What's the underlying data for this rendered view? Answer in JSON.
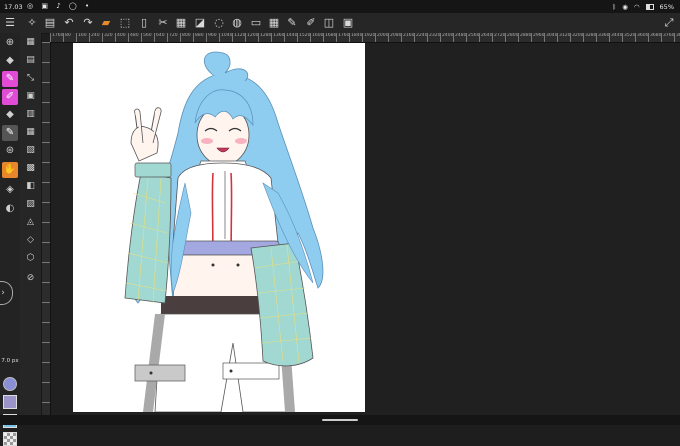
{
  "status_bar": {
    "time": "17.03",
    "notification_icons": [
      "whatsapp-icon",
      "gallery-icon",
      "music-icon",
      "chat-icon",
      "dot-icon"
    ],
    "right_icons": [
      "bluetooth-icon",
      "eye-icon",
      "wifi-icon",
      "battery-icon"
    ],
    "battery": "65%"
  },
  "toolbar": {
    "icons": [
      "menu-icon",
      "quick-access-icon",
      "save-icon",
      "undo-icon",
      "redo-icon",
      "brush-preset-icon",
      "transform-icon",
      "clear-layer-icon",
      "cut-icon",
      "paste-icon",
      "fill-icon",
      "lasso-icon",
      "gallery-icon",
      "folder-icon",
      "grid-icon",
      "pen-icon",
      "pen-alt-icon",
      "ruler-icon",
      "layer-props-icon",
      "fullscreen-icon"
    ]
  },
  "ruler": {
    "top_ticks": [
      "1760",
      "80",
      "160",
      "240",
      "320",
      "400",
      "480",
      "560",
      "640",
      "720",
      "800",
      "880",
      "960",
      "1040",
      "1120",
      "1200",
      "1280",
      "1360",
      "1440",
      "1520",
      "1600",
      "1680",
      "1760",
      "1840",
      "1920",
      "2000",
      "2080",
      "2160",
      "2240",
      "2320",
      "2400",
      "2480",
      "2560",
      "2640",
      "2720",
      "2800",
      "2880",
      "2960",
      "3040",
      "3120",
      "3200",
      "3280",
      "3360",
      "3440",
      "3520",
      "3600",
      "3680",
      "3760",
      "3840",
      "3920",
      "4000"
    ]
  },
  "left_tools": {
    "icons": [
      "selection-icon",
      "eraser-icon",
      "pen-icon",
      "marker-icon",
      "eraser-alt-icon",
      "blur-icon",
      "airbrush-icon",
      "smudge-icon",
      "fill-bucket-icon",
      "gradient-icon"
    ],
    "brush_size": "7.0 px",
    "brush_size_value": 7.0
  },
  "side_tools": {
    "icons": [
      "canvas-icon",
      "layers-icon",
      "adjust-icon",
      "filter-icon",
      "text-icon",
      "ruler-icon",
      "frame-icon",
      "copy-icon",
      "tone-icon",
      "stamp-icon",
      "watermark-icon",
      "layer-stack-icon",
      "layer-3d-icon",
      "rotate-icon"
    ]
  },
  "colors": {
    "main_color": "#9b94c8",
    "sub_color": "#79c2ea",
    "accent": "#e68a2e"
  }
}
